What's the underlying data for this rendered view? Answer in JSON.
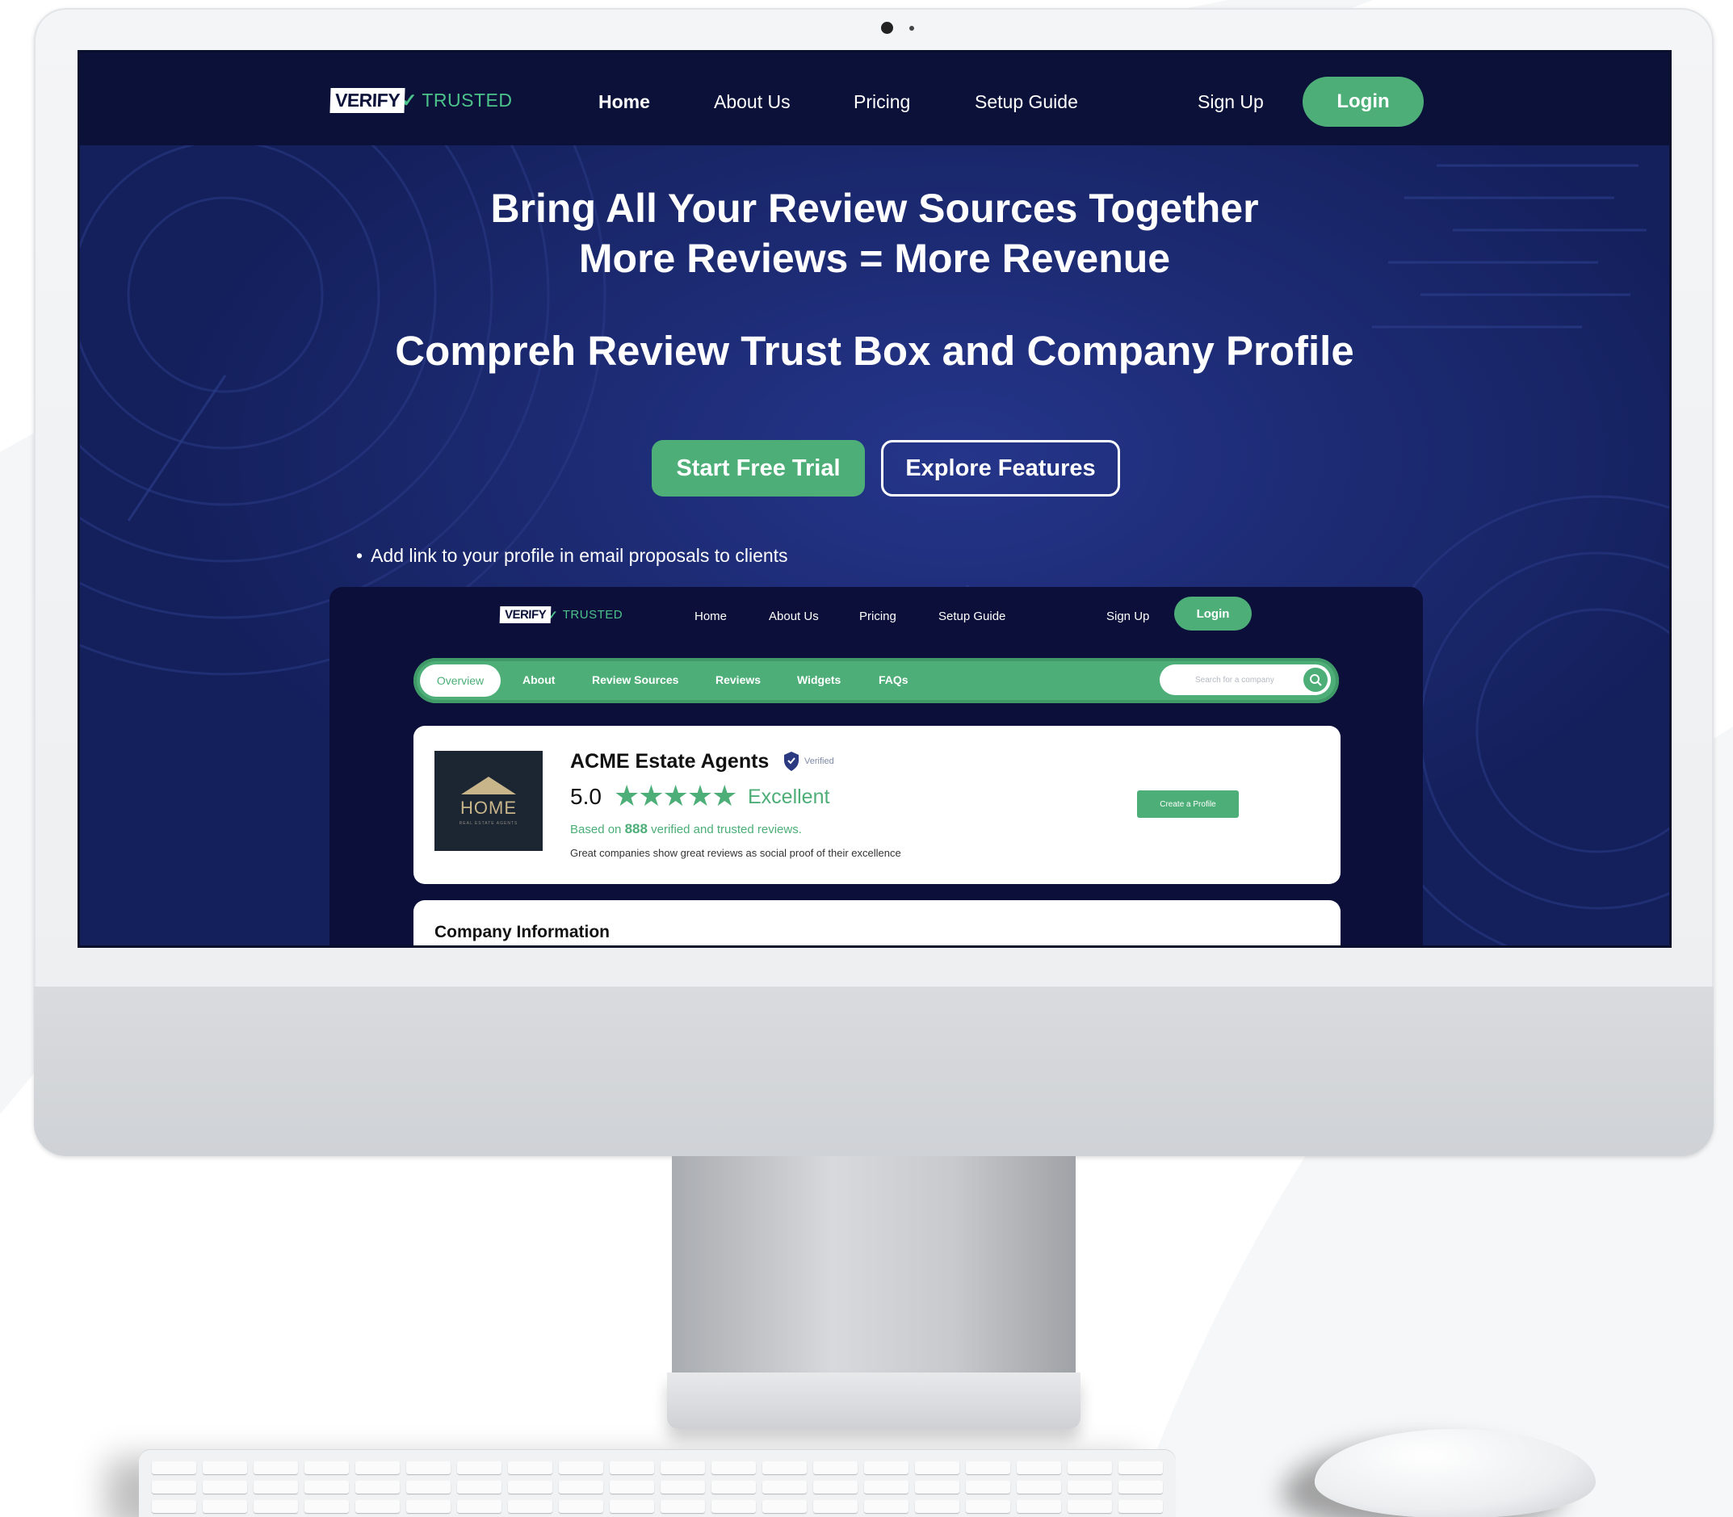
{
  "nav": {
    "logo_verify": "VERIFY",
    "logo_trusted": "TRUSTED",
    "links": [
      "Home",
      "About Us",
      "Pricing",
      "Setup Guide",
      "Sign Up"
    ],
    "login": "Login"
  },
  "hero": {
    "title_line1": "Bring All Your Review Sources Together",
    "title_line2": "More Reviews = More Revenue",
    "subtitle": "Compreh Review Trust Box and Company Profile",
    "cta_primary": "Start Free Trial",
    "cta_secondary": "Explore Features",
    "bullet": "Add link to your profile in email proposals to clients"
  },
  "inner": {
    "logo_verify": "VERIFY",
    "logo_trusted": "TRUSTED",
    "links": [
      "Home",
      "About Us",
      "Pricing",
      "Setup Guide",
      "Sign Up"
    ],
    "login": "Login",
    "tabs": [
      "Overview",
      "About",
      "Review Sources",
      "Reviews",
      "Widgets",
      "FAQs"
    ],
    "search_placeholder": "Search for a company",
    "company": {
      "logo_word": "HOME",
      "logo_tag": "REAL ESTATE AGENTS",
      "name": "ACME Estate Agents",
      "verified": "Verified",
      "rating": "5.0",
      "stars": "★★★★★",
      "rating_word": "Excellent",
      "based_prefix": "Based on",
      "review_count": "888",
      "based_suffix": "verified and trusted reviews.",
      "tagline": "Great companies show great reviews as social proof of their excellence",
      "create_profile": "Create a Profile"
    },
    "info_title": "Company Information"
  },
  "colors": {
    "accent_green": "#4dae78",
    "nav_dark": "#0b1139",
    "hero_blue": "#14205c"
  }
}
